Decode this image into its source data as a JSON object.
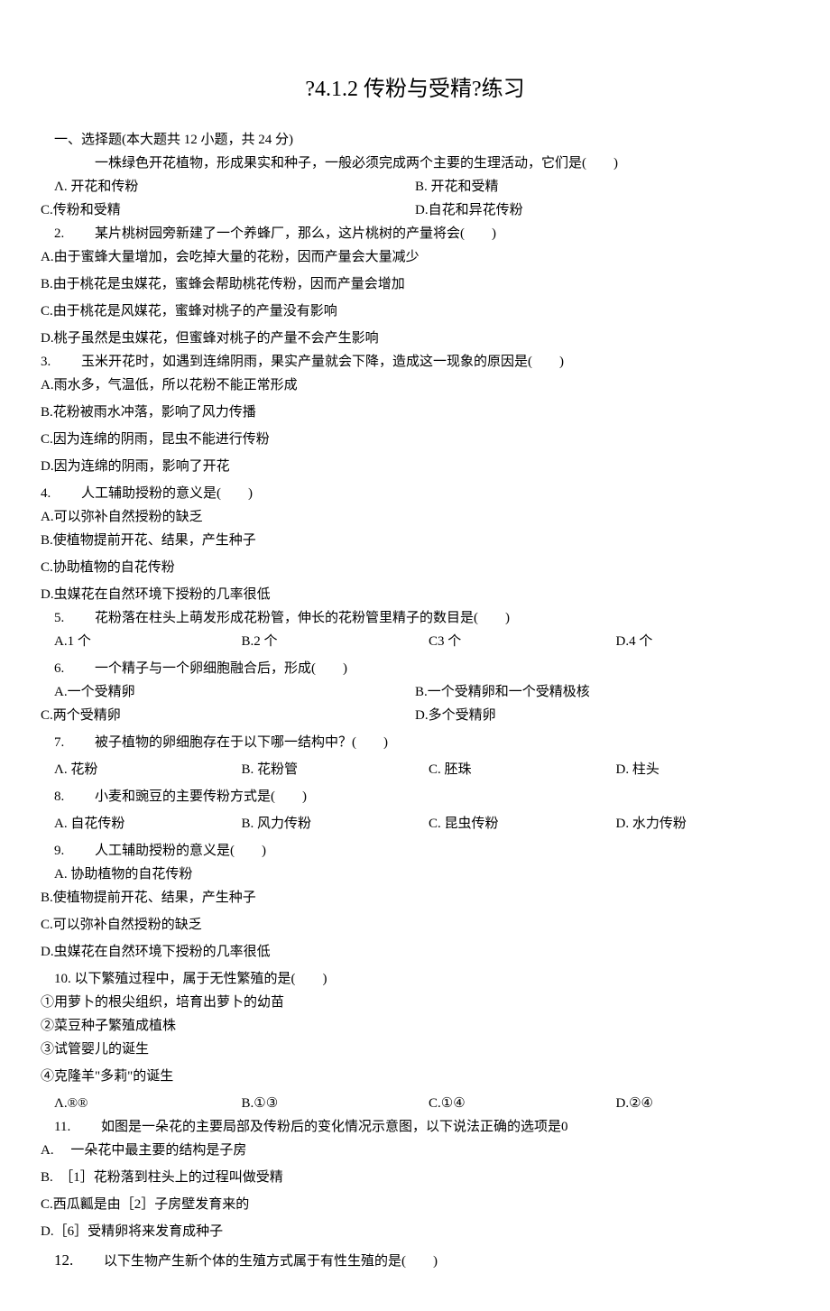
{
  "title": "?4.1.2 传粉与受精?练习",
  "section_header": "一、选择题(本大题共 12 小题，共 24 分)",
  "q1": {
    "stem": "一株绿色开花植物，形成果实和种子，一般必须完成两个主要的生理活动，它们是(　　)",
    "a": "Λ. 开花和传粉",
    "b": "B. 开花和受精",
    "c": "C.传粉和受精",
    "d": "D.自花和异花传粉"
  },
  "q2": {
    "num": "2.",
    "stem": "某片桃树园旁新建了一个养蜂厂，那么，这片桃树的产量将会(　　)",
    "a": "A.由于蜜蜂大量增加，会吃掉大量的花粉，因而产量会大量减少",
    "b": "B.由于桃花是虫媒花，蜜蜂会帮助桃花传粉，因而产量会增加",
    "c": "C.由于桃花是风媒花，蜜蜂对桃子的产量没有影响",
    "d": "D.桃子虽然是虫媒花，但蜜蜂对桃子的产量不会产生影响"
  },
  "q3": {
    "num": "3.",
    "stem": "玉米开花时，如遇到连绵阴雨，果实产量就会下降，造成这一现象的原因是(　　)",
    "a": "A.雨水多，气温低，所以花粉不能正常形成",
    "b": "B.花粉被雨水冲落，影响了风力传播",
    "c": "C.因为连绵的阴雨，昆虫不能进行传粉",
    "d": "D.因为连绵的阴雨，影响了开花"
  },
  "q4": {
    "num": "4.",
    "stem": "人工辅助授粉的意义是(　　)",
    "a": "A.可以弥补自然授粉的缺乏",
    "b": "B.使植物提前开花、结果，产生种子",
    "c": "C.协助植物的自花传粉",
    "d": "D.虫媒花在自然环境下授粉的几率很低"
  },
  "q5": {
    "num": "5.",
    "stem": "花粉落在柱头上萌发形成花粉管，伸长的花粉管里精子的数目是(　　)",
    "a": "A.1 个",
    "b": "B.2 个",
    "c": "C3 个",
    "d": "D.4 个"
  },
  "q6": {
    "num": "6.",
    "stem": "一个精子与一个卵细胞融合后，形成(　　)",
    "a": "A.一个受精卵",
    "b": "B.一个受精卵和一个受精极核",
    "c": "C.两个受精卵",
    "d": "D.多个受精卵"
  },
  "q7": {
    "num": "7.",
    "stem": "被子植物的卵细胞存在于以下哪一结构中？(　　)",
    "a": "Λ. 花粉",
    "b": "B. 花粉管",
    "c": "C. 胚珠",
    "d": "D. 柱头"
  },
  "q8": {
    "num": "8.",
    "stem": "小麦和豌豆的主要传粉方式是(　　)",
    "a": "A. 自花传粉",
    "b": "B. 风力传粉",
    "c": "C. 昆虫传粉",
    "d": "D. 水力传粉"
  },
  "q9": {
    "num": "9.",
    "stem": "人工辅助授粉的意义是(　　)",
    "a": "A. 协助植物的自花传粉",
    "b": "B.使植物提前开花、结果，产生种子",
    "c": "C.可以弥补自然授粉的缺乏",
    "d": "D.虫媒花在自然环境下授粉的几率很低"
  },
  "q10": {
    "num": "10.",
    "stem": "以下繁殖过程中，属于无性繁殖的是(　　)",
    "l1": "①用萝卜的根尖组织，培育出萝卜的幼苗",
    "l2": "②菜豆种子繁殖成植株",
    "l3": "③试管婴儿的诞生",
    "l4": "④克隆羊\"多莉\"的诞生",
    "a": "Λ.®®",
    "b": "B.①③",
    "c": "C.①④",
    "d": "D.②④"
  },
  "q11": {
    "num": "11.",
    "stem": "如图是一朵花的主要局部及传粉后的变化情况示意图，以下说法正确的选项是0",
    "a": "A.　 一朵花中最主要的结构是子房",
    "b": "B.　［1］花粉落到柱头上的过程叫做受精",
    "c": "C.西瓜瓤是由［2］子房壁发育来的",
    "d": "D.［6］受精卵将来发育成种子"
  },
  "q12": {
    "num": "12.",
    "stem": "以下生物产生新个体的生殖方式属于有性生殖的是(　　)"
  }
}
